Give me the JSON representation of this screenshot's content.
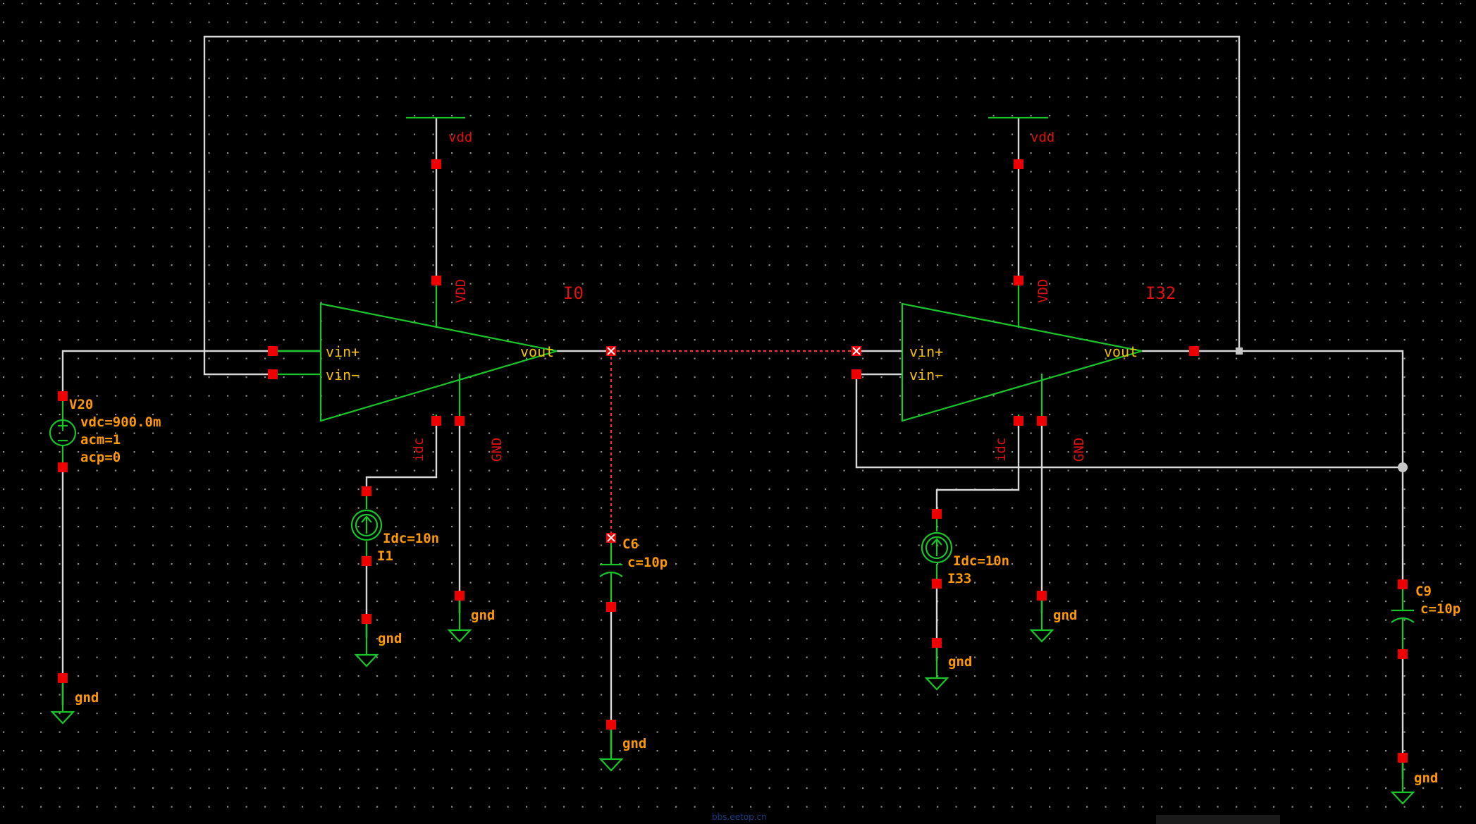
{
  "opamps": {
    "first": {
      "instance": "I0",
      "supply_net": "vdd",
      "pins": {
        "vin_plus": "vin+",
        "vin_minus": "vin−",
        "vout": "vout",
        "vdd": "VDD",
        "idc": "idc",
        "gnd": "GND"
      }
    },
    "second": {
      "instance": "I32",
      "supply_net": "vdd",
      "pins": {
        "vin_plus": "vin+",
        "vin_minus": "vin−",
        "vout": "vout",
        "vdd": "VDD",
        "idc": "idc",
        "gnd": "GND"
      }
    }
  },
  "vsource": {
    "name": "V20",
    "vdc": "vdc=900.0m",
    "acm": "acm=1",
    "acp": "acp=0",
    "gnd": "gnd"
  },
  "current_sources": [
    {
      "name": "I1",
      "idc": "Idc=10n",
      "gnd": "gnd"
    },
    {
      "name": "I33",
      "idc": "Idc=10n",
      "gnd": "gnd"
    }
  ],
  "capacitors": [
    {
      "name": "C6",
      "value": "c=10p",
      "gnd": "gnd"
    },
    {
      "name": "C9",
      "value": "c=10p",
      "gnd": "gnd"
    }
  ],
  "gnd_labels": {
    "opamp1": "gnd",
    "opamp2": "gnd"
  },
  "watermark": "bbs.eetop.cn",
  "colors": {
    "background": "#000000",
    "wire": "#d8d8d8",
    "symbol": "#19c62a",
    "pin": "#ee0000",
    "label": "#f5c000",
    "param": "#ff9900"
  }
}
